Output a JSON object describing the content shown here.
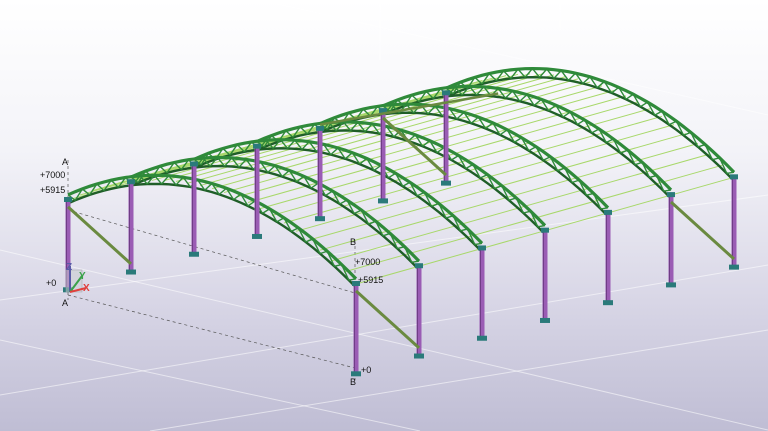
{
  "viewport": {
    "grid_lines": {
      "A": {
        "label": "A",
        "levels": [
          "+7000",
          "+5915",
          "+0"
        ]
      },
      "B": {
        "label": "B",
        "levels": [
          "+7000",
          "+5915",
          "+0"
        ]
      }
    },
    "axes": {
      "x": "X",
      "y": "Y",
      "z": "Z"
    },
    "colors": {
      "truss": "#2f8a3a",
      "truss_dark": "#1f5e28",
      "purlin": "#a8d86a",
      "column": "#9a5cb4",
      "column_dark": "#6f3d86",
      "brace": "#6a8a40",
      "base": "#2a7a7a",
      "grid": "#9aa0a8",
      "axis_x": "#e0403c",
      "axis_y": "#3aa24a",
      "axis_z": "#5a5aa8"
    }
  }
}
